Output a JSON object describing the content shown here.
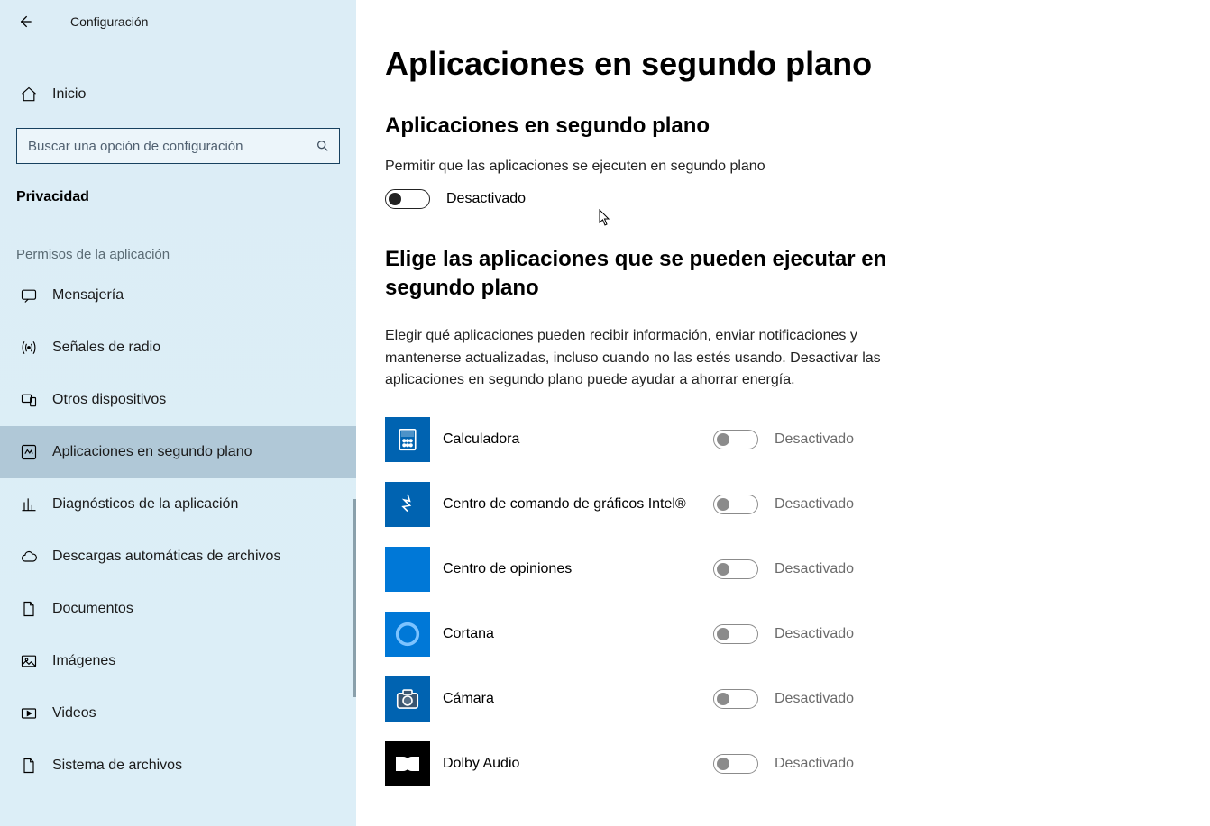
{
  "header": {
    "title": "Configuración"
  },
  "home": {
    "label": "Inicio"
  },
  "search": {
    "placeholder": "Buscar una opción de configuración"
  },
  "section": {
    "title": "Privacidad",
    "sub": "Permisos de la aplicación"
  },
  "nav": [
    {
      "id": "mensajeria",
      "label": "Mensajería",
      "icon": "chat"
    },
    {
      "id": "senales-radio",
      "label": "Señales de radio",
      "icon": "radio"
    },
    {
      "id": "otros-dispositivos",
      "label": "Otros dispositivos",
      "icon": "devices"
    },
    {
      "id": "apps-segundo-plano",
      "label": "Aplicaciones en segundo plano",
      "icon": "bgapp",
      "selected": true
    },
    {
      "id": "diagnosticos",
      "label": "Diagnósticos de la aplicación",
      "icon": "diag"
    },
    {
      "id": "descargas-auto",
      "label": "Descargas automáticas de archivos",
      "icon": "cloud"
    },
    {
      "id": "documentos",
      "label": "Documentos",
      "icon": "doc"
    },
    {
      "id": "imagenes",
      "label": "Imágenes",
      "icon": "image"
    },
    {
      "id": "videos",
      "label": "Videos",
      "icon": "video"
    },
    {
      "id": "sistema-archivos",
      "label": "Sistema de archivos",
      "icon": "doc"
    }
  ],
  "main": {
    "page_title": "Aplicaciones en segundo plano",
    "sub_title": "Aplicaciones en segundo plano",
    "desc": "Permitir que las aplicaciones se ejecuten en segundo plano",
    "master_toggle_state": "Desactivado",
    "choose_title": "Elige las aplicaciones que se pueden ejecutar en segundo plano",
    "choose_desc": "Elegir qué aplicaciones pueden recibir información, enviar notificaciones y mantenerse actualizadas, incluso cuando no las estés usando. Desactivar las aplicaciones en segundo plano puede ayudar a ahorrar energía.",
    "apps": [
      {
        "name": "Calculadora",
        "state": "Desactivado",
        "icon": "calc",
        "bg": "#0063b1"
      },
      {
        "name": "Centro de comando de gráficos Intel®",
        "state": "Desactivado",
        "icon": "intel",
        "bg": "#0063b1"
      },
      {
        "name": "Centro de opiniones",
        "state": "Desactivado",
        "icon": "blank",
        "bg": "#0078d7"
      },
      {
        "name": "Cortana",
        "state": "Desactivado",
        "icon": "cortana",
        "bg": "#0078d7"
      },
      {
        "name": "Cámara",
        "state": "Desactivado",
        "icon": "camera",
        "bg": "#0063b1"
      },
      {
        "name": "Dolby Audio",
        "state": "Desactivado",
        "icon": "dolby",
        "bg": "#000000"
      }
    ]
  }
}
